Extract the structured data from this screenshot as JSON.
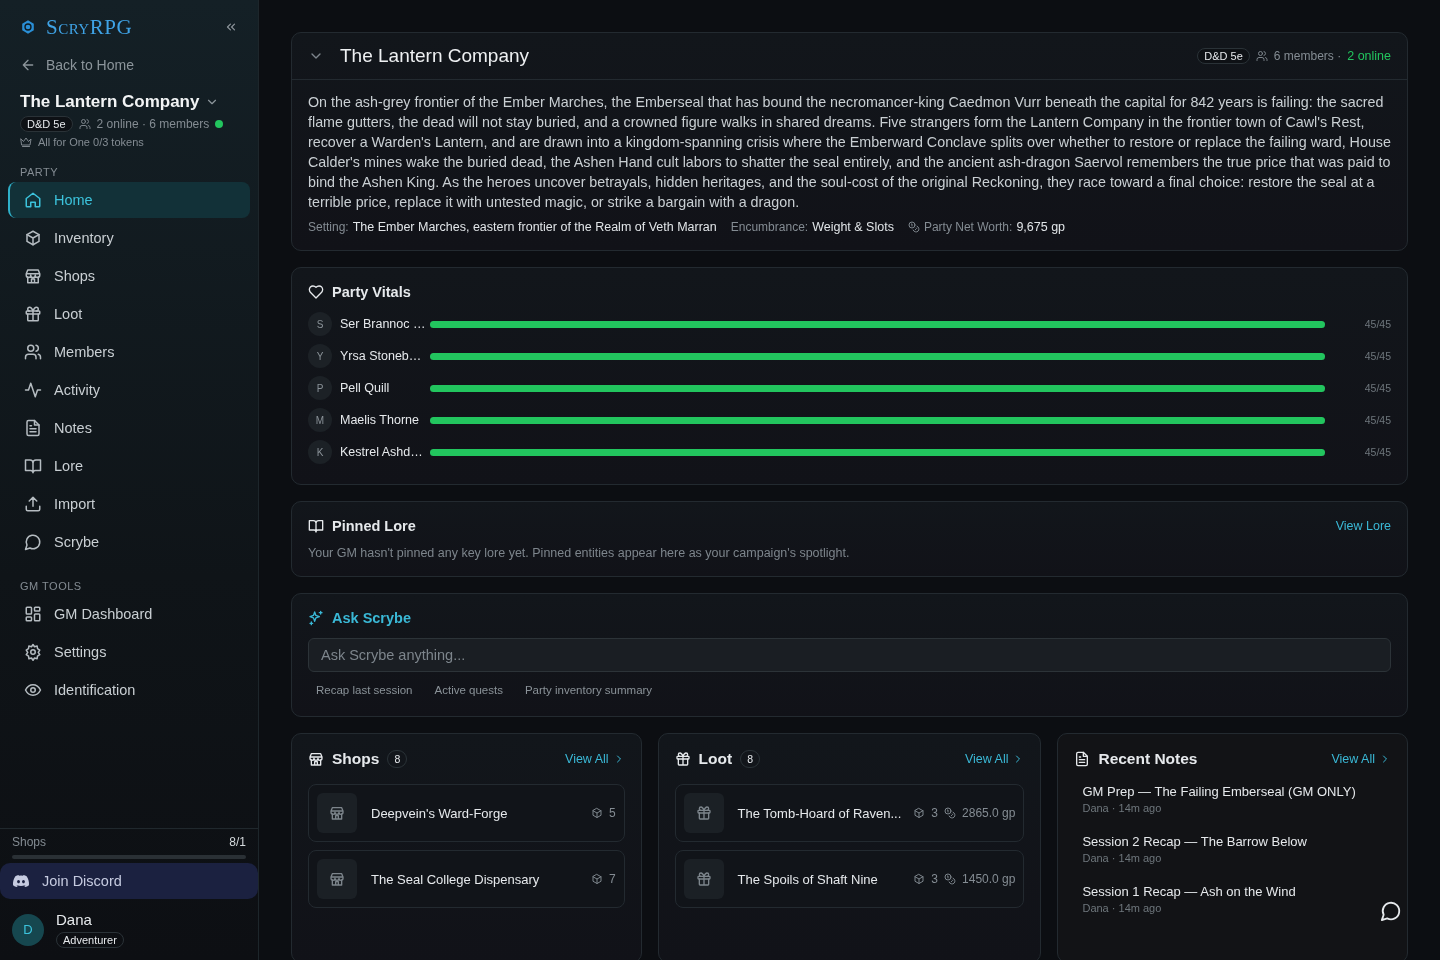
{
  "sidebar": {
    "logo": "ScryRPG",
    "back_link": "Back to Home",
    "campaign": {
      "name": "The Lantern Company",
      "system": "D&D 5e",
      "presence": "2 online · 6 members",
      "online": true,
      "tokens": "All for One 0/3 tokens"
    },
    "sections": [
      {
        "heading": "PARTY",
        "items": [
          {
            "label": "Home",
            "selected": true
          },
          {
            "label": "Inventory",
            "selected": false
          },
          {
            "label": "Shops",
            "selected": false
          },
          {
            "label": "Loot",
            "selected": false
          },
          {
            "label": "Members",
            "selected": false
          },
          {
            "label": "Activity",
            "selected": false
          },
          {
            "label": "Notes",
            "selected": false
          },
          {
            "label": "Lore",
            "selected": false
          },
          {
            "label": "Import",
            "selected": false
          },
          {
            "label": "Scrybe",
            "selected": false
          }
        ]
      },
      {
        "heading": "GM TOOLS",
        "items": [
          {
            "label": "GM Dashboard",
            "selected": false
          },
          {
            "label": "Settings",
            "selected": false
          },
          {
            "label": "Identification",
            "selected": false
          }
        ]
      }
    ],
    "usage": {
      "label": "Shops",
      "value": "8/1"
    },
    "discord": "Join Discord",
    "user": {
      "initial": "D",
      "name": "Dana",
      "role": "Adventurer"
    }
  },
  "campaign_card": {
    "title": "The Lantern Company",
    "system": "D&D 5e",
    "members": "6 members ·",
    "online": "2 online",
    "description": "On the ash-grey frontier of the Ember Marches, the Emberseal that has bound the necromancer-king Caedmon Vurr beneath the capital for 842 years is failing: the sacred flame gutters, the dead will not stay buried, and a crowned figure walks in shared dreams. Five strangers form the Lantern Company in the frontier town of Cawl's Rest, recover a Warden's Lantern, and are drawn into a kingdom-spanning crisis where the Emberward Conclave splits over whether to restore or replace the failing ward, House Calder's mines wake the buried dead, the Ashen Hand cult labors to shatter the seal entirely, and the ancient ash-dragon Saervol remembers the true price that was paid to bind the Ashen King. As the heroes uncover betrayals, hidden heritages, and the soul-cost of the original Reckoning, they race toward a final choice: restore the seal at a terrible price, replace it with untested magic, or strike a bargain with a dragon.",
    "setting_label": "Setting:",
    "setting": "The Ember Marches, eastern frontier of the Realm of Veth Marran",
    "encumbrance_label": "Encumbrance:",
    "encumbrance": "Weight & Slots",
    "worth_label": "Party Net Worth:",
    "worth": "9,675 gp"
  },
  "vitals": {
    "title": "Party Vitals",
    "members": [
      {
        "initial": "S",
        "name": "Ser Brannoc …",
        "level": 1,
        "reading": "45/45"
      },
      {
        "initial": "Y",
        "name": "Yrsa Stoneb…",
        "level": 1,
        "reading": "45/45"
      },
      {
        "initial": "P",
        "name": "Pell Quill",
        "level": 1,
        "reading": "45/45"
      },
      {
        "initial": "M",
        "name": "Maelis Thorne",
        "level": 1,
        "reading": "45/45"
      },
      {
        "initial": "K",
        "name": "Kestrel Ashd…",
        "level": 1,
        "reading": "45/45"
      }
    ]
  },
  "pinned_lore": {
    "title": "Pinned Lore",
    "link": "View Lore",
    "empty_text": "Your GM hasn't pinned any key lore yet. Pinned entities appear here as your campaign's spotlight."
  },
  "ask": {
    "title": "Ask Scrybe",
    "placeholder": "Ask Scrybe anything...",
    "suggestions": [
      "Recap last session",
      "Active quests",
      "Party inventory summary"
    ]
  },
  "shops": {
    "title": "Shops",
    "count": "8",
    "link": "View All",
    "items": [
      {
        "name": "Deepvein's Ward-Forge",
        "count": "5"
      },
      {
        "name": "The Seal College Dispensary",
        "count": "7"
      }
    ]
  },
  "loot": {
    "title": "Loot",
    "count": "8",
    "link": "View All",
    "items": [
      {
        "name": "The Tomb-Hoard of Raven...",
        "count": "3",
        "value": "2865.0 gp"
      },
      {
        "name": "The Spoils of Shaft Nine",
        "count": "3",
        "value": "1450.0 gp"
      }
    ]
  },
  "notes": {
    "title": "Recent Notes",
    "link": "View All",
    "items": [
      {
        "title": "GM Prep — The Failing Emberseal (GM ONLY)",
        "meta": "Dana · 14m ago"
      },
      {
        "title": "Session 2 Recap — The Barrow Below",
        "meta": "Dana · 14m ago"
      },
      {
        "title": "Session 1 Recap — Ash on the Wind",
        "meta": "Dana · 14m ago"
      }
    ]
  }
}
